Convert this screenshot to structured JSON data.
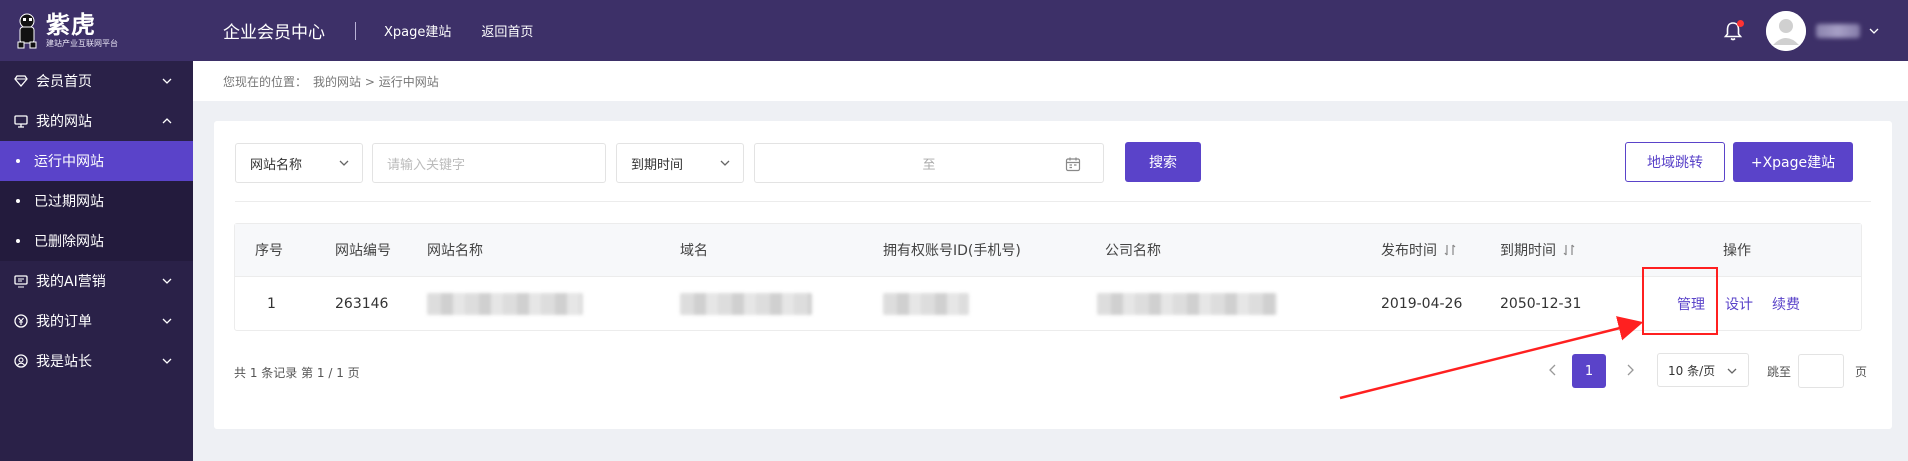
{
  "logo": {
    "title": "紫虎",
    "subtitle": "建站产业互联网平台"
  },
  "topbar": {
    "title": "企业会员中心",
    "links": [
      "Xpage建站",
      "返回首页"
    ]
  },
  "sidebar": {
    "items": [
      {
        "label": "会员首页",
        "icon": "diamond-icon",
        "expanded": false
      },
      {
        "label": "我的网站",
        "icon": "monitor-icon",
        "expanded": true,
        "children": [
          {
            "label": "运行中网站",
            "active": true
          },
          {
            "label": "已过期网站",
            "active": false
          },
          {
            "label": "已删除网站",
            "active": false
          }
        ]
      },
      {
        "label": "我的AI营销",
        "icon": "ai-monitor-icon",
        "expanded": false
      },
      {
        "label": "我的订单",
        "icon": "yen-icon",
        "expanded": false
      },
      {
        "label": "我是站长",
        "icon": "user-circle-icon",
        "expanded": false
      }
    ]
  },
  "breadcrumb": {
    "prefix": "您现在的位置：",
    "path": "我的网站 > 运行中网站"
  },
  "filters": {
    "field_select": "网站名称",
    "keyword_placeholder": "请输入关键字",
    "date_type_select": "到期时间",
    "date_range_sep": "至",
    "search_button": "搜索",
    "region_button": "地域跳转",
    "xpage_button": "+Xpage建站"
  },
  "table": {
    "columns": [
      "序号",
      "网站编号",
      "网站名称",
      "域名",
      "拥有权账号ID(手机号)",
      "公司名称",
      "发布时间",
      "到期时间",
      "操作"
    ],
    "rows": [
      {
        "index": "1",
        "site_id": "263146",
        "published": "2019-04-26",
        "expires": "2050-12-31",
        "actions": [
          "管理",
          "设计",
          "续费"
        ]
      }
    ]
  },
  "pagination": {
    "summary": "共 1 条记录 第 1 / 1 页",
    "current_page": "1",
    "page_size": "10 条/页",
    "jump_label": "跳至",
    "page_unit": "页"
  },
  "colors": {
    "brand": "#5a43c9",
    "sidebar": "#2a2148",
    "topbar": "#3d3068",
    "annotation": "#ff2020"
  }
}
